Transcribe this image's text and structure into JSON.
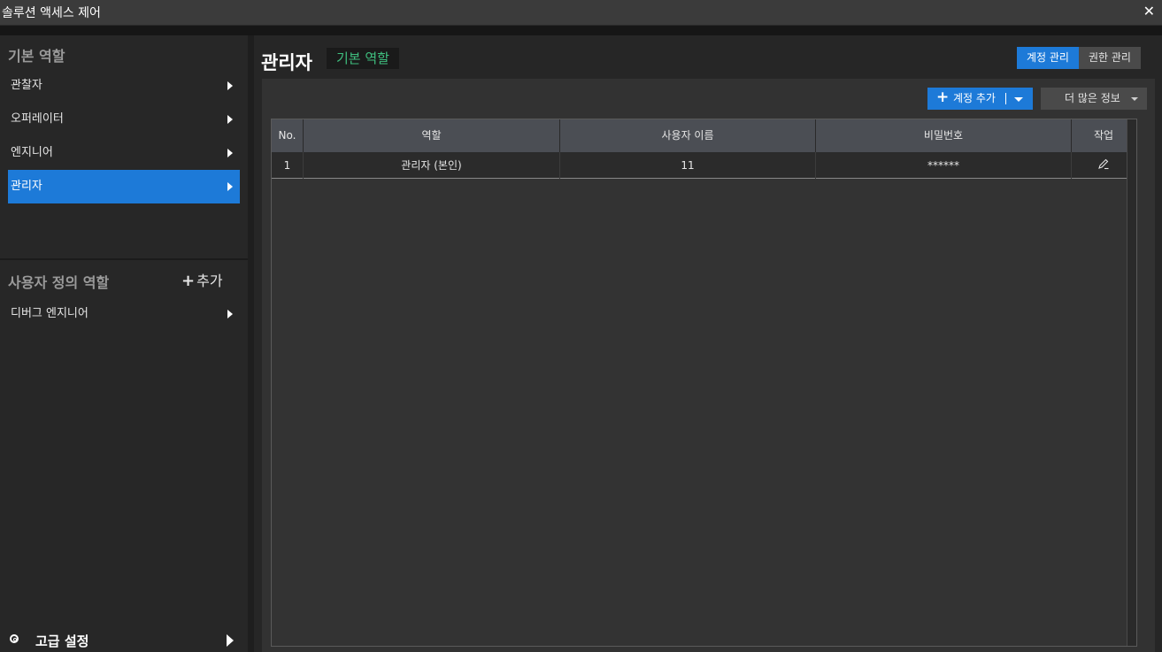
{
  "window": {
    "title": "솔루션 액세스 제어",
    "close_glyph": "✕"
  },
  "sidebar": {
    "basic_title": "기본 역할",
    "basic_items": [
      {
        "label": "관찰자",
        "active": false
      },
      {
        "label": "오퍼레이터",
        "active": false
      },
      {
        "label": "엔지니어",
        "active": false
      },
      {
        "label": "관리자",
        "active": true
      }
    ],
    "custom_title": "사용자 정의 역할",
    "add_plus": "+",
    "add_label": "추가",
    "custom_items": [
      {
        "label": "디버그 엔지니어"
      }
    ],
    "advanced_label": "고급 설정"
  },
  "main": {
    "title": "관리자",
    "role_badge": "기본 역할",
    "tabs": [
      {
        "label": "계정 관리",
        "active": true
      },
      {
        "label": "권한 관리",
        "active": false
      }
    ],
    "add_account_label": "계정 추가",
    "more_info_label": "더 많은 정보"
  },
  "table": {
    "headers": [
      "No.",
      "역할",
      "사용자 이름",
      "비밀번호",
      "작업"
    ],
    "rows": [
      [
        "1",
        "관리자 (본인)",
        "11",
        "******"
      ]
    ]
  },
  "colors": {
    "accent": "#1d7ad8",
    "badge_text": "#3fbf7f"
  },
  "icons": {
    "close": "close-icon",
    "arrow": "chevron-right-icon",
    "edit": "pencil-icon",
    "settings": "settings-icon"
  }
}
